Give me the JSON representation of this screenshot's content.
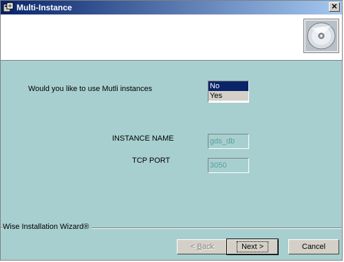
{
  "window": {
    "title": "Multi-Instance",
    "close_glyph": "✕"
  },
  "banner": {
    "icon": "cd-disc-icon"
  },
  "multi_instance": {
    "prompt": "Would you like to use Mutli instances",
    "options": [
      "No",
      "Yes"
    ],
    "selected": "No"
  },
  "instance": {
    "label": "INSTANCE NAME",
    "value": "gds_db"
  },
  "tcp": {
    "label": "TCP PORT",
    "value": "3050"
  },
  "footer": {
    "brand": "Wise Installation Wizard®"
  },
  "buttons": {
    "back_prefix": "< ",
    "back_hot": "B",
    "back_rest": "ack",
    "next": "Next >",
    "cancel": "Cancel"
  }
}
